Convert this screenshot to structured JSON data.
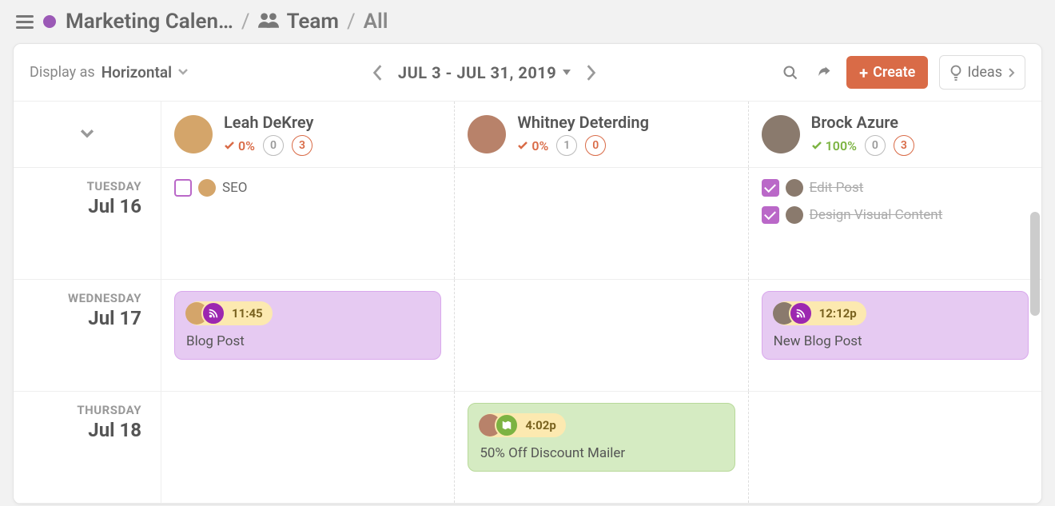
{
  "breadcrumb": {
    "calendar_name": "Marketing Calen…",
    "team_label": "Team",
    "filter_label": "All"
  },
  "toolbar": {
    "display_as_label": "Display as",
    "display_as_value": "Horizontal",
    "date_range": "JUL 3 - JUL 31, 2019",
    "create_label": "Create",
    "ideas_label": "Ideas"
  },
  "team": [
    {
      "name": "Leah DeKrey",
      "percent": "0%",
      "stat1": "0",
      "stat2": "3",
      "pct_color": "orange"
    },
    {
      "name": "Whitney Deterding",
      "percent": "0%",
      "stat1": "1",
      "stat2": "0",
      "pct_color": "orange"
    },
    {
      "name": "Brock Azure",
      "percent": "100%",
      "stat1": "0",
      "stat2": "3",
      "pct_color": "green"
    }
  ],
  "days": [
    {
      "dow": "TUESDAY",
      "date": "Jul 16",
      "cells": [
        {
          "tasks": [
            {
              "done": false,
              "name": "SEO"
            }
          ]
        },
        {},
        {
          "tasks": [
            {
              "done": true,
              "name": "Edit Post"
            },
            {
              "done": true,
              "name": "Design Visual Content"
            }
          ]
        }
      ]
    },
    {
      "dow": "WEDNESDAY",
      "date": "Jul 17",
      "cells": [
        {
          "card": {
            "color": "purple",
            "time": "11:45",
            "title": "Blog Post",
            "badge": "rss"
          }
        },
        {},
        {
          "card": {
            "color": "purple",
            "time": "12:12p",
            "title": "New Blog Post",
            "badge": "rss"
          }
        }
      ]
    },
    {
      "dow": "THURSDAY",
      "date": "Jul 18",
      "cells": [
        {},
        {
          "card": {
            "color": "green",
            "time": "4:02p",
            "title": "50% Off Discount Mailer",
            "badge": "map"
          }
        },
        {}
      ]
    }
  ]
}
